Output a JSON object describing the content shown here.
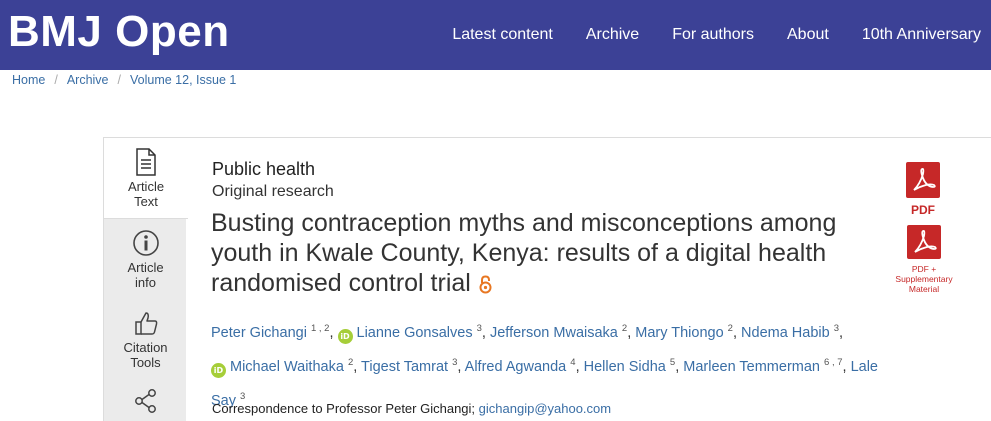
{
  "header": {
    "logo": "BMJ Open",
    "nav": [
      "Latest content",
      "Archive",
      "For authors",
      "About",
      "10th Anniversary"
    ]
  },
  "breadcrumb": [
    "Home",
    "Archive",
    "Volume 12, Issue 1"
  ],
  "tools": {
    "article_text": [
      "Article",
      "Text"
    ],
    "article_info": [
      "Article",
      "info"
    ],
    "citation_tools": [
      "Citation",
      "Tools"
    ]
  },
  "article": {
    "section": "Public health",
    "type": "Original research",
    "title": "Busting contraception myths and misconceptions among youth in Kwale County, Kenya: results of a digital health randomised control trial",
    "authors": [
      {
        "name": "Peter Gichangi",
        "aff": "1 , 2",
        "orcid": false
      },
      {
        "name": "Lianne Gonsalves",
        "aff": "3",
        "orcid": true
      },
      {
        "name": "Jefferson Mwaisaka",
        "aff": "2",
        "orcid": false
      },
      {
        "name": "Mary Thiongo",
        "aff": "2",
        "orcid": false
      },
      {
        "name": "Ndema Habib",
        "aff": "3",
        "orcid": false
      },
      {
        "name": "Michael Waithaka",
        "aff": "2",
        "orcid": true
      },
      {
        "name": "Tigest Tamrat",
        "aff": "3",
        "orcid": false
      },
      {
        "name": "Alfred Agwanda",
        "aff": "4",
        "orcid": false
      },
      {
        "name": "Hellen Sidha",
        "aff": "5",
        "orcid": false
      },
      {
        "name": "Marleen Temmerman",
        "aff": "6 , 7",
        "orcid": false
      },
      {
        "name": "Lale Say",
        "aff": "3",
        "orcid": false
      }
    ],
    "correspondence_label": "Correspondence to Professor Peter Gichangi;",
    "correspondence_email": "gichangip@yahoo.com"
  },
  "downloads": {
    "pdf_label": "PDF",
    "pdf_supp_line1": "PDF +",
    "pdf_supp_line2": "Supplementary",
    "pdf_supp_line3": "Material"
  },
  "colors": {
    "header_bg": "#3c4196",
    "link": "#3a6ea5",
    "pdf_red": "#c62828",
    "orcid_green": "#a6ce39",
    "open_access_orange": "#e87722"
  }
}
